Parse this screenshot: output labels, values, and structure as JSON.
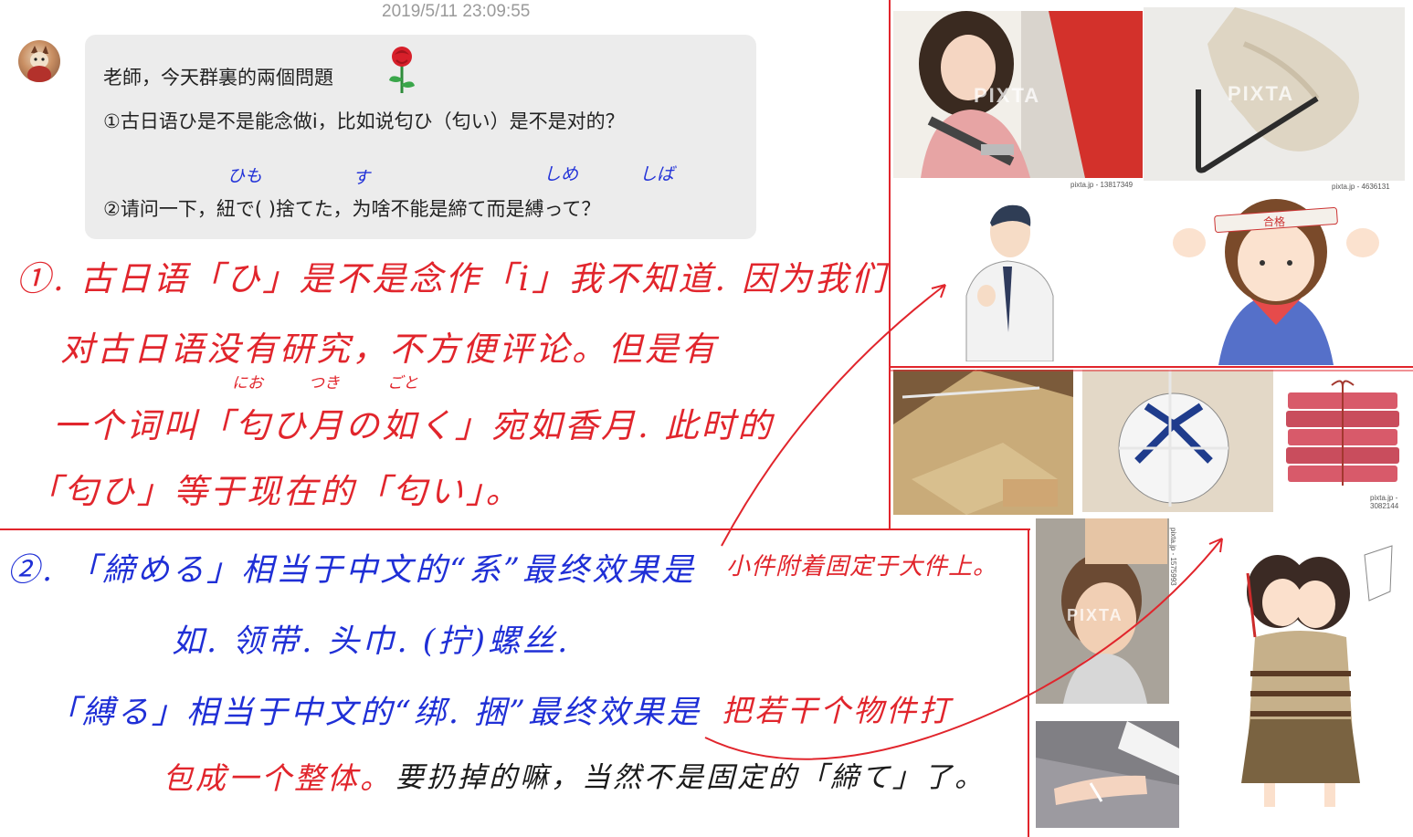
{
  "chat": {
    "timestamp": "2019/5/11 23:09:55",
    "line1": "老師，今天群裏的兩個問題",
    "line2": "①古日语ひ是不是能念做i，比如说匂ひ（匂い）是不是对的？",
    "line3": "②请问一下，紐で(      )捨てた，为啥不能是締て而是縛って？",
    "ruby": {
      "himo": "ひも",
      "su": "す",
      "shime": "しめ",
      "shiba": "しば"
    }
  },
  "answer1": {
    "line1": "①. 古日语「ひ」是不是念作「i」我不知道. 因为我们",
    "line2": "对古日语没有研究，不方便评论。但是有",
    "line3": "一个词叫「匂ひ月の如く」宛如香月. 此时的",
    "line4": "「匂ひ」等于现在的「匂い」。",
    "ruby_nioi": "にお",
    "ruby_tsuki": "つき",
    "ruby_gotoku": "ごと"
  },
  "answer2": {
    "line1_blue": "②. 「締める」相当于中文的“系”最终效果是",
    "line1_red": "小件附着固定于大件上。",
    "line2_blue": "如. 领带. 头巾. (拧)螺丝.",
    "line3_blue": "「縛る」相当于中文的“绑. 捆”最终效果是",
    "line3_red": "把若干个物件打",
    "line4_red": "包成一个整体。",
    "line4_black": "要扔掉的嘛，当然不是固定的「締て」了。"
  },
  "images": {
    "watermark": "PIXTA",
    "caption1": "pixta.jp - 13817349",
    "caption2": "pixta.jp - 4636131",
    "caption3": "pixta.jp - 3082144",
    "caption4": "pixta.jp - 1575993",
    "headband_text": "合格"
  },
  "colors": {
    "red": "#e1252c",
    "blue": "#1f2fd6",
    "bubble": "#ececec"
  }
}
